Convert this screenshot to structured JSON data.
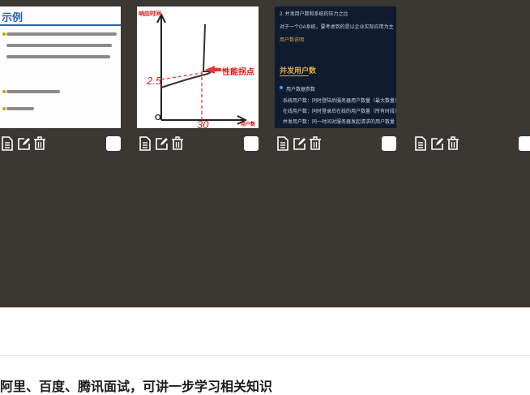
{
  "slides": [
    {
      "title": "示例",
      "lines": [
        "一个OA系统，当系统有2000个用户，平均每天大约有400个用户",
        "访问该系统，对一个典型用户来说，一天内登录到退出系统",
        "期，是其次使用该系统相关的时间为4小时",
        "C=约 (？400×4/8=200)",
        "C^(200×2)/8≈?"
      ]
    },
    {
      "y_axis_label": "响应时间",
      "x_axis_label": "用户数",
      "annotation": "性能拐点",
      "hand_x": "30",
      "hand_y": "2.5",
      "origin": "O"
    },
    {
      "lines_top": [
        "2. 并发用户数和系统的压力之比",
        "对于一个OA系统，要考虑到的是以企业实际应用为主"
      ],
      "marker": "用户数说明",
      "heading": "并发用户数",
      "bullets": [
        "用户数据参数",
        "系统用户数：同时登陆后服务器用户数量（最大数量）",
        "在线用户数：同时登录后在线的用户数量（所有时段）",
        "并发用户数：同一时间对服务器发起请求的用户数量"
      ]
    }
  ],
  "toolbar_icons": [
    "document-icon",
    "edit-icon",
    "trash-icon"
  ],
  "bottom": {
    "heading": "阿里、百度、腾讯面试，可讲一步学习相关知识"
  }
}
